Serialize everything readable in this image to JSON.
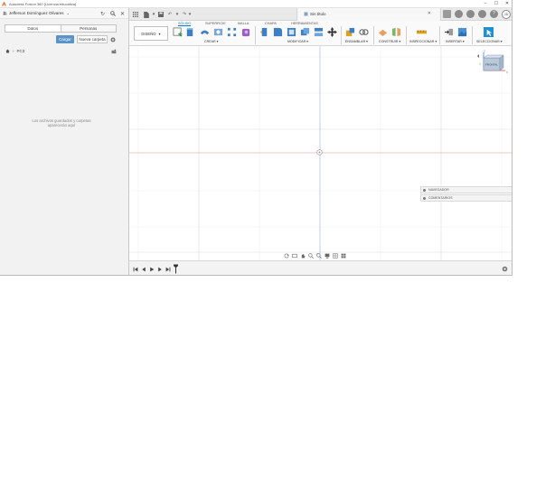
{
  "window": {
    "title": "Autodesk Fusion 360 (Licencia educativa)",
    "controls": [
      "–",
      "☐",
      "✕"
    ]
  },
  "data_panel": {
    "user_name": "Jefferson Domínguez Olivares",
    "tabs": [
      {
        "label": "Datos",
        "active": true
      },
      {
        "label": "Personas",
        "active": false
      }
    ],
    "upload_label": "Cargar",
    "new_folder_label": "Nueva carpeta",
    "breadcrumb": "PC3",
    "empty_message": "Los archivos guardados y carpetas aparecerán aquí"
  },
  "appbar": {
    "document_title": "Sin título",
    "avatar_initials": "JD",
    "help": "?"
  },
  "ribbon": {
    "workspace": "DISEÑO",
    "tabs": [
      {
        "label": "SÓLIDO",
        "active": true
      },
      {
        "label": "SUPERFICIE",
        "active": false
      },
      {
        "label": "MALLA",
        "active": false
      },
      {
        "label": "CHAPA",
        "active": false
      },
      {
        "label": "HERRAMIENTAS",
        "active": false
      }
    ],
    "groups": [
      "CREAR",
      "MODIFICAR",
      "ENSAMBLAR",
      "CONSTRUIR",
      "INSPECCIONAR",
      "INSERTAR",
      "SELECCIONAR"
    ]
  },
  "viewcube": {
    "face_label": "FRONTAL",
    "axis_labels": [
      "Z",
      "X",
      "Y"
    ]
  },
  "browser_panels": [
    {
      "label": "NAVEGADOR"
    },
    {
      "label": "COMENTARIOS"
    }
  ],
  "colors": {
    "accent": "#0b7ac9",
    "upload_button": "#5b93c7",
    "x_axis": "#e9a0a0",
    "y_axis": "#a9a9e6",
    "logo": "#f26b21"
  }
}
